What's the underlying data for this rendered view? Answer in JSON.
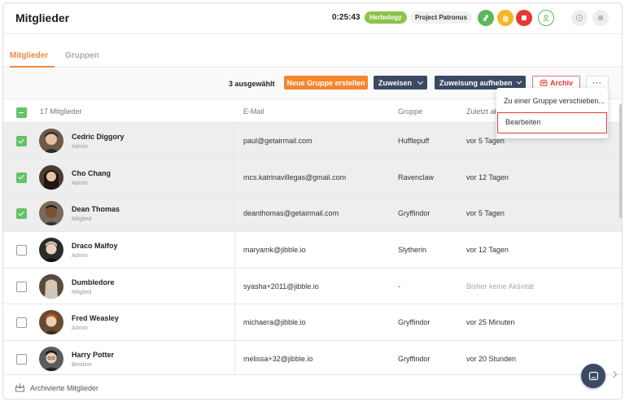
{
  "header": {
    "title": "Mitglieder",
    "timer": "0:25:43",
    "activity_label": "Herbology",
    "project_label": "Project Patronus"
  },
  "tabs": [
    {
      "label": "Mitglieder",
      "active": true
    },
    {
      "label": "Gruppen",
      "active": false
    }
  ],
  "toolbar": {
    "selected_count": "3 ausgewählt",
    "new_group": "Neue Gruppe erstellen",
    "assign": "Zuweisen",
    "unassign": "Zuweisung aufheben",
    "archive": "Archiv",
    "more": "···"
  },
  "table": {
    "headers": {
      "members": "17 Mitglieder",
      "email": "E-Mail",
      "group": "Gruppe",
      "last": "Zuletzt ak"
    },
    "rows": [
      {
        "name": "Cedric Diggory",
        "role": "Admin",
        "email": "paul@getairmail.com",
        "group": "Hufflepuff",
        "last": "vor 5 Tagen",
        "selected": true
      },
      {
        "name": "Cho Chang",
        "role": "Admin",
        "email": "mcs.katrinavillegas@gmail.com",
        "group": "Ravenclaw",
        "last": "vor 12 Tagen",
        "selected": true
      },
      {
        "name": "Dean Thomas",
        "role": "Mitglied",
        "email": "deanthomas@getairmail.com",
        "group": "Gryffindor",
        "last": "vor 5 Tagen",
        "selected": true
      },
      {
        "name": "Draco Malfoy",
        "role": "Admin",
        "email": "maryamk@jibble.io",
        "group": "Slytherin",
        "last": "vor 12 Tagen",
        "selected": false
      },
      {
        "name": "Dumbledore",
        "role": "Mitglied",
        "email": "syasha+2011@jibble.io",
        "group": "-",
        "last": "Bisher keine Aktivität",
        "selected": false
      },
      {
        "name": "Fred Weasley",
        "role": "Admin",
        "email": "michaera@jibble.io",
        "group": "Gryffindor",
        "last": "vor 25 Minuten",
        "selected": false
      },
      {
        "name": "Harry Potter",
        "role": "Besitzer",
        "email": "melissa+32@jibble.io",
        "group": "Gryffindor",
        "last": "vor 20 Stunden",
        "selected": false
      }
    ]
  },
  "menu": {
    "items": [
      {
        "label": "Zu einer Gruppe verschieben..."
      },
      {
        "label": "Bearbeiten"
      }
    ]
  },
  "footer": {
    "archived_label": "Archivierte Mitglieder"
  },
  "colors": {
    "accent": "#f5852d",
    "dark_button": "#3a4a63",
    "check_green": "#64c267",
    "highlight_red": "#e53935"
  }
}
